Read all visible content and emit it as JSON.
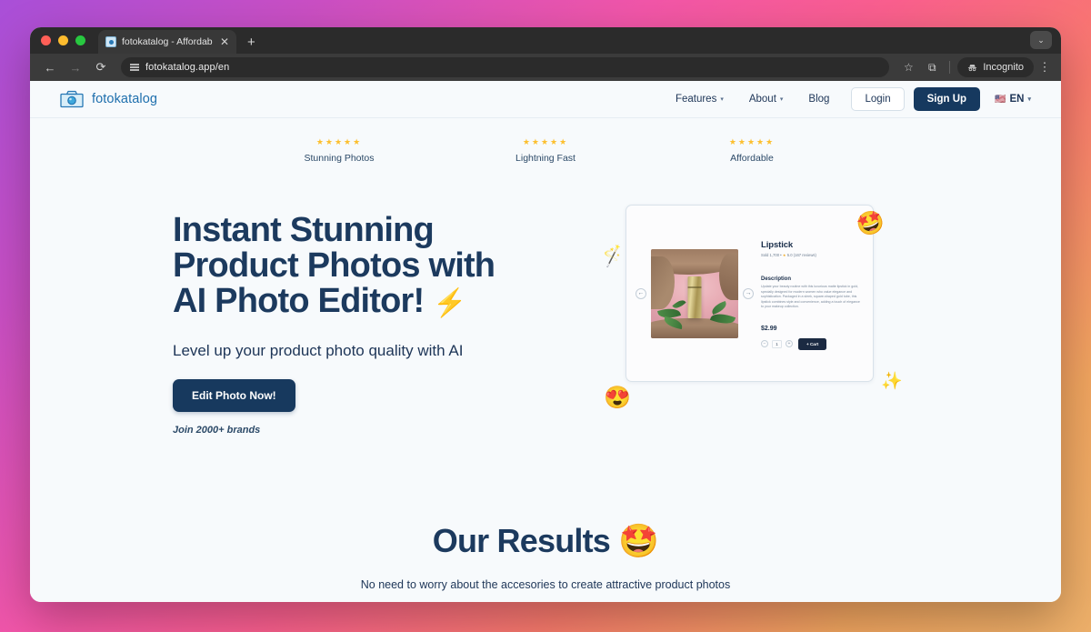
{
  "browser": {
    "tab": {
      "title": "fotokatalog - Affordable and ",
      "favicon": "camera-favicon",
      "close": "✕"
    },
    "new_tab": "+",
    "collapse": "⌄",
    "back": "←",
    "forward": "→",
    "reload": "⟳",
    "url": "fotokatalog.app/en",
    "bookmark": "☆",
    "share": "⧉",
    "incognito_label": "Incognito",
    "menu": "⋮"
  },
  "site": {
    "brand": "fotokatalog",
    "nav": [
      {
        "label": "Features",
        "caret": "▾"
      },
      {
        "label": "About",
        "caret": "▾"
      },
      {
        "label": "Blog",
        "caret": ""
      }
    ],
    "login": "Login",
    "signup": "Sign Up",
    "language": {
      "flag": "🇺🇸",
      "code": "EN",
      "caret": "▾"
    }
  },
  "trust": [
    {
      "stars": "★★★★★",
      "label": "Stunning Photos"
    },
    {
      "stars": "★★★★★",
      "label": "Lightning Fast"
    },
    {
      "stars": "★★★★★",
      "label": "Affordable"
    }
  ],
  "hero": {
    "title_line1": "Instant Stunning",
    "title_line2": "Product Photos with",
    "title_line3": "AI Photo Editor!",
    "title_emoji": "⚡",
    "subtitle": "Level up your product photo quality with AI",
    "cta": "Edit Photo Now!",
    "brands": "Join 2000+ brands"
  },
  "product_card": {
    "prev_arrow": "←",
    "next_arrow": "→",
    "title": "Lipstick",
    "meta": "Sold 1,700  •  ",
    "meta_star": "★",
    "meta_rating": " 5.0 (167 reviews)",
    "description_heading": "Description",
    "description_body": "Update your beauty routine with this luxurious matte lipstick in gold, specially designed for modern women who value elegance and sophistication. Packaged in a sleek, square-shaped gold tube, this lipstick combines style and convenience, adding a touch of elegance to your makeup collection.",
    "price": "$2.99",
    "qty_minus": "−",
    "qty_value": "1",
    "qty_plus": "+",
    "cart_button": "+ Cart",
    "decorations": {
      "wand": "🪄",
      "star_struck": "🤩",
      "heart_eyes": "😍",
      "sparkles": "✨"
    }
  },
  "results": {
    "title": "Our Results",
    "title_emoji": "🤩",
    "subtitle": "No need to worry about the accesories to create attractive product photos"
  },
  "colors": {
    "navy": "#1c3a5e",
    "brand_blue": "#1e6fad",
    "star_gold": "#fcbf2e",
    "page_bg": "#f7fafc"
  }
}
